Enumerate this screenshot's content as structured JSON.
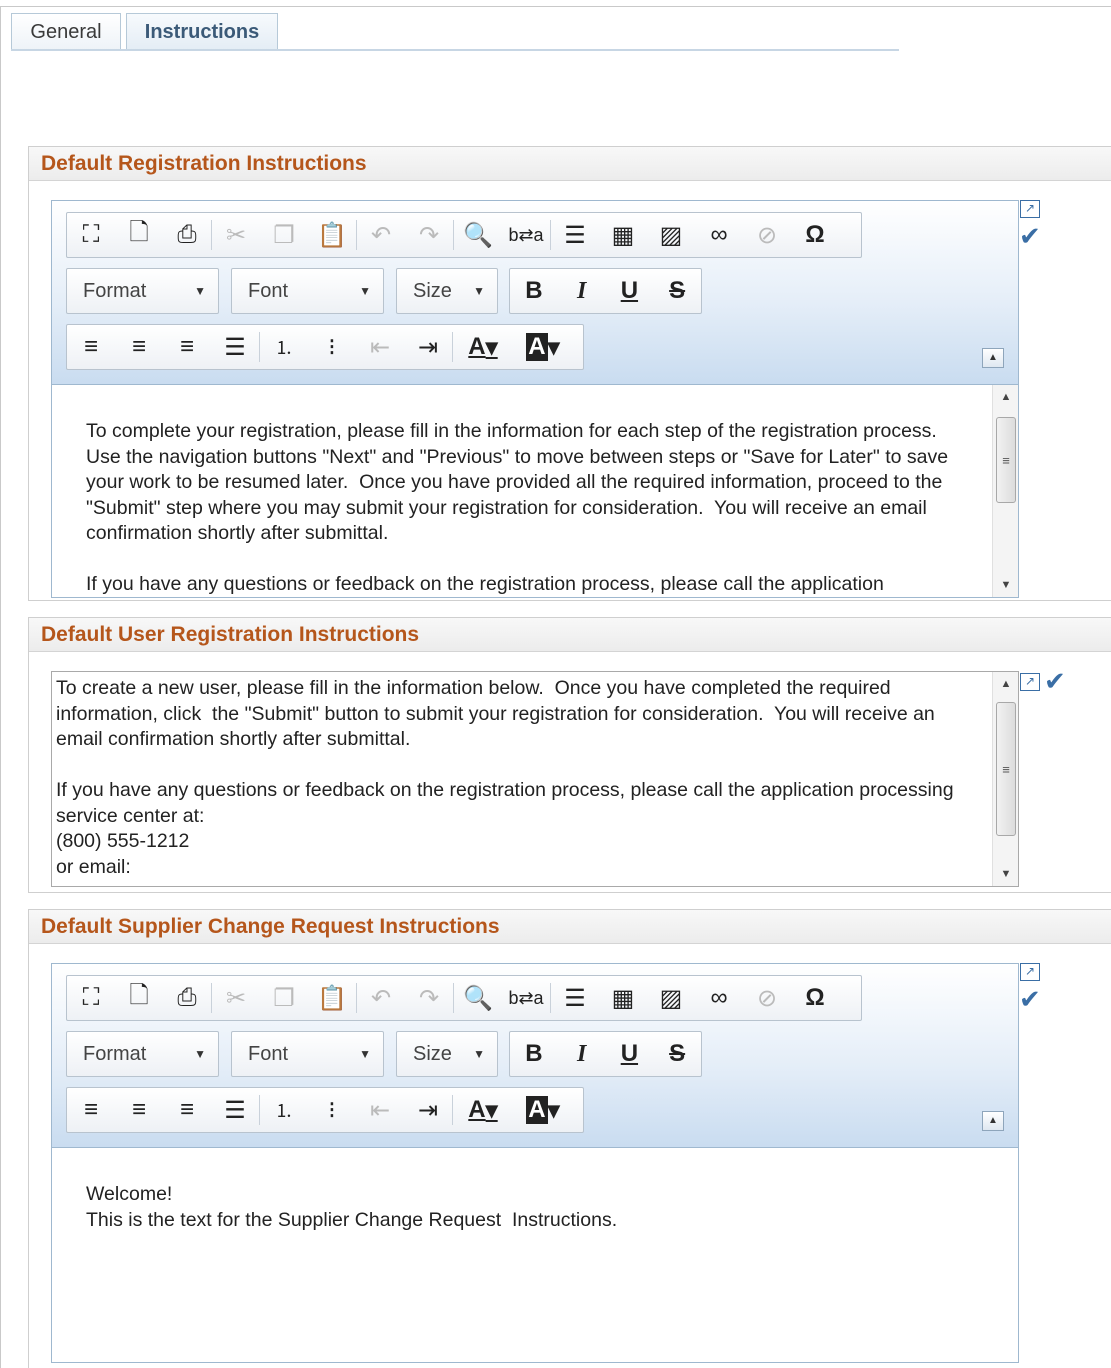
{
  "tabs": [
    {
      "label": "General"
    },
    {
      "label": "Instructions"
    }
  ],
  "toolbar": {
    "row1": [
      "maximize-icon",
      "preview-icon",
      "print-icon",
      "cut-icon",
      "copy-icon",
      "paste-icon",
      "undo-icon",
      "redo-icon",
      "find-icon",
      "replace-icon",
      "horizontal-line-icon",
      "table-icon",
      "image-icon",
      "link-icon",
      "unlink-icon",
      "special-char-icon"
    ],
    "format_label": "Format",
    "font_label": "Font",
    "size_label": "Size",
    "bold": "B",
    "italic": "I",
    "underline": "U",
    "strike": "S",
    "omega": "Ω",
    "text_color": "A",
    "bg_color": "A"
  },
  "sections": {
    "registration": {
      "title": "Default Registration Instructions",
      "content": "To complete your registration, please fill in the information for each step of the registration process.  Use the navigation buttons \"Next\" and \"Previous\" to move between steps or \"Save for Later\" to save your work to be resumed later.  Once you have provided all the required information, proceed to the \"Submit\" step where you may submit your registration for consideration.  You will receive an email confirmation shortly after submittal.\n\nIf you have any questions or feedback on the registration process, please call the application"
    },
    "user_registration": {
      "title": "Default User Registration Instructions",
      "content": "To create a new user, please fill in the information below.  Once you have completed the required information, click  the \"Submit\" button to submit your registration for consideration.  You will receive an email confirmation shortly after submittal.\n\nIf you have any questions or feedback on the registration process, please call the application processing service center at:\n(800) 555-1212\nor email:"
    },
    "supplier_change": {
      "title": "Default Supplier Change Request Instructions",
      "content": "Welcome!\nThis is the text for the Supplier Change Request  Instructions."
    }
  }
}
